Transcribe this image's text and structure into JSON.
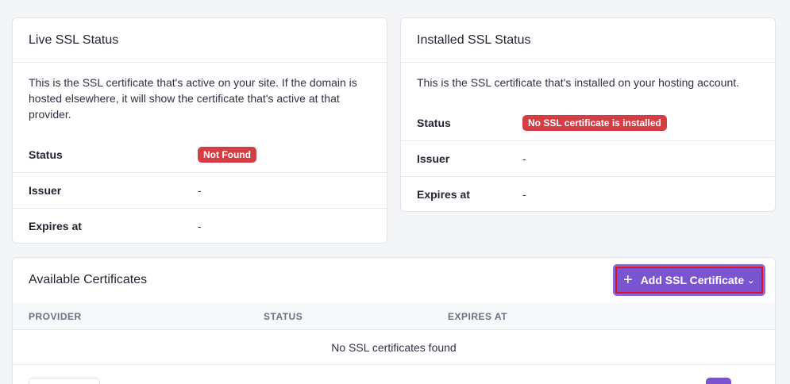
{
  "live_ssl": {
    "title": "Live SSL Status",
    "description": "This is the SSL certificate that's active on your site. If the domain is hosted elsewhere, it will show the certificate that's active at that provider.",
    "status_label": "Status",
    "status_value": "Not Found",
    "issuer_label": "Issuer",
    "issuer_value": "-",
    "expires_label": "Expires at",
    "expires_value": "-"
  },
  "installed_ssl": {
    "title": "Installed SSL Status",
    "description": "This is the SSL certificate that's installed on your hosting account.",
    "status_label": "Status",
    "status_value": "No SSL certificate is installed",
    "issuer_label": "Issuer",
    "issuer_value": "-",
    "expires_label": "Expires at",
    "expires_value": "-"
  },
  "available": {
    "title": "Available Certificates",
    "add_button_label": "Add SSL Certificate",
    "columns": [
      "PROVIDER",
      "STATUS",
      "EXPIRES AT"
    ],
    "empty_message": "No SSL certificates found"
  },
  "colors": {
    "badge_red": "#d43d43",
    "accent_purple": "#7a55cf",
    "highlight_red": "#e0102a"
  },
  "icons": {
    "add": "plus-icon",
    "dropdown": "chevron-down-icon"
  }
}
